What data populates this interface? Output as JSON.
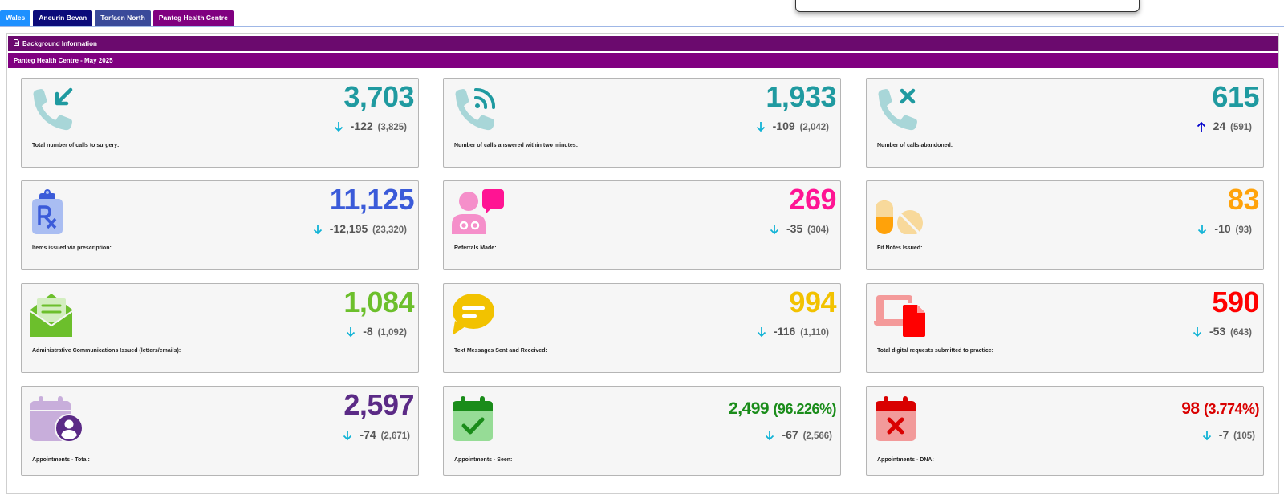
{
  "tabs": [
    {
      "label": "Wales",
      "color": "#1e90ff"
    },
    {
      "label": "Aneurin Bevan",
      "color": "#0b0b7a"
    },
    {
      "label": "Torfaen North",
      "color": "#3a4a9a"
    },
    {
      "label": "Panteg Health Centre",
      "color": "#800080"
    }
  ],
  "sections": {
    "background_info": "Background Information",
    "practice_title": "Panteg Health Centre - May 2025"
  },
  "cards": [
    {
      "label": "Total number of calls to surgery:",
      "value": "3,703",
      "change": "-122",
      "previous": "(3,825)",
      "trend": "down",
      "color": "#1f9aa0",
      "icon": "phone-incoming-icon"
    },
    {
      "label": "Number of calls answered within two minutes:",
      "value": "1,933",
      "change": "-109",
      "previous": "(2,042)",
      "trend": "down",
      "color": "#1f9aa0",
      "icon": "phone-answered-icon"
    },
    {
      "label": "Number of calls abandoned:",
      "value": "615",
      "change": "24",
      "previous": "(591)",
      "trend": "up",
      "color": "#1f9aa0",
      "icon": "phone-missed-icon"
    },
    {
      "label": "Items issued via prescription:",
      "value": "11,125",
      "change": "-12,195",
      "previous": "(23,320)",
      "trend": "down",
      "color": "#3b5bd9",
      "icon": "prescription-icon"
    },
    {
      "label": "Referrals Made:",
      "value": "269",
      "change": "-35",
      "previous": "(304)",
      "trend": "down",
      "color": "#ff1493",
      "icon": "doctor-chat-icon"
    },
    {
      "label": "Fit Notes Issued:",
      "value": "83",
      "change": "-10",
      "previous": "(93)",
      "trend": "down",
      "color": "#ffa20a",
      "icon": "pills-icon"
    },
    {
      "label": "Administrative Communications Issued (letters/emails):",
      "value": "1,084",
      "change": "-8",
      "previous": "(1,092)",
      "trend": "down",
      "color": "#6cbf2c",
      "icon": "envelope-open-icon"
    },
    {
      "label": "Text Messages Sent and Received:",
      "value": "994",
      "change": "-116",
      "previous": "(1,110)",
      "trend": "down",
      "color": "#f2c200",
      "icon": "chat-bubble-icon"
    },
    {
      "label": "Total digital requests submitted to practice:",
      "value": "590",
      "change": "-53",
      "previous": "(643)",
      "trend": "down",
      "color": "#ff0000",
      "icon": "laptop-file-icon"
    },
    {
      "label": "Appointments - Total:",
      "value": "2,597",
      "percent": "",
      "change": "-74",
      "previous": "(2,671)",
      "trend": "down",
      "color": "#5b2a86",
      "icon": "calendar-user-icon"
    },
    {
      "label": "Appointments - Seen:",
      "value": "2,499",
      "percent": "(96.226%)",
      "change": "-67",
      "previous": "(2,566)",
      "trend": "down",
      "color": "#1a8c1a",
      "icon": "calendar-check-icon"
    },
    {
      "label": "Appointments - DNA:",
      "value": "98",
      "percent": "(3.774%)",
      "change": "-7",
      "previous": "(105)",
      "trend": "down",
      "color": "#d90000",
      "icon": "calendar-x-icon"
    }
  ],
  "colors": {
    "arrow_down": "#11b3d6",
    "arrow_up": "#0000cc"
  }
}
